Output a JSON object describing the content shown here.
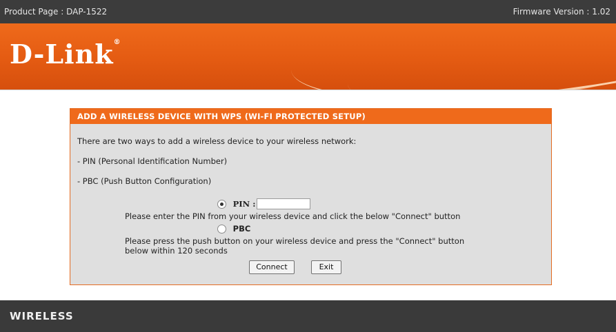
{
  "topbar": {
    "product_page": "Product Page : DAP-1522",
    "firmware_version": "Firmware Version : 1.02"
  },
  "brand": {
    "logo_text": "D-Link",
    "registered_mark": "®"
  },
  "panel": {
    "title": "ADD A WIRELESS DEVICE WITH WPS (WI-FI PROTECTED SETUP)",
    "intro": "There are two ways to add a wireless device to your wireless network:",
    "methods": [
      "- PIN (Personal Identification Number)",
      "- PBC (Push Button Configuration)"
    ],
    "pin_option": {
      "label": "PIN :",
      "selected": true,
      "instructions": "Please enter the PIN from your wireless device and click the below \"Connect\" button",
      "value": ""
    },
    "pbc_option": {
      "label": "PBC",
      "selected": false,
      "instructions_line1": "Please press the push button on your wireless device and press the \"Connect\" button",
      "instructions_line2": "below within 120 seconds"
    },
    "buttons": {
      "connect": "Connect",
      "exit": "Exit"
    }
  },
  "footer": {
    "label": "WIRELESS"
  },
  "colors": {
    "orange": "#ef6a1b",
    "dark": "#3a3a3a",
    "panel_bg": "#dfdfdf"
  }
}
